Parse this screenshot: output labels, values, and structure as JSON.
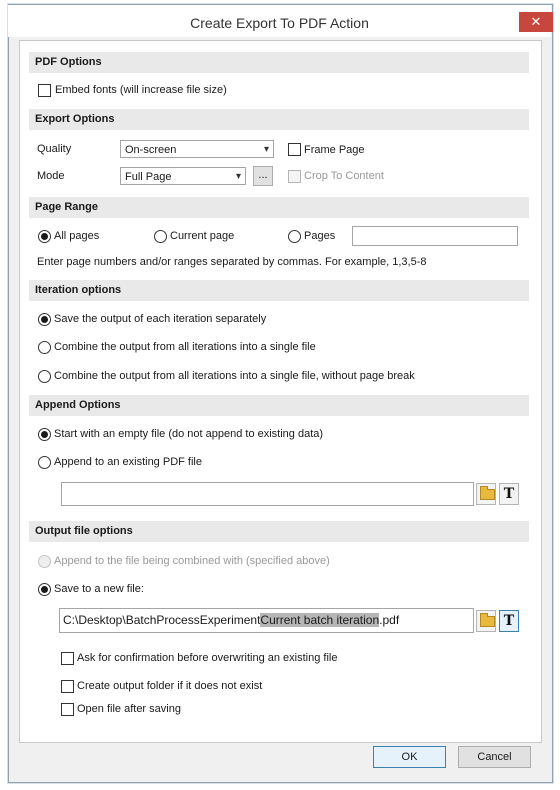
{
  "window": {
    "title": "Create Export To PDF Action",
    "close_icon": "✕"
  },
  "pdf_options": {
    "header": "PDF Options",
    "embed_fonts": "Embed fonts (will increase file size)"
  },
  "export_options": {
    "header": "Export Options",
    "quality_label": "Quality",
    "quality_value": "On-screen",
    "frame_page": "Frame Page",
    "mode_label": "Mode",
    "mode_value": "Full Page",
    "ellipsis": "...",
    "crop_to_content": "Crop To Content"
  },
  "page_range": {
    "header": "Page Range",
    "all_pages": "All pages",
    "current_page": "Current page",
    "pages": "Pages",
    "pages_value": "",
    "hint": "Enter page numbers and/or ranges separated by commas. For example, 1,3,5-8"
  },
  "iteration": {
    "header": "Iteration options",
    "opt1": "Save the output of each iteration separately",
    "opt2": "Combine the output from all iterations into a single file",
    "opt3": "Combine the output from all iterations into a single file, without page break"
  },
  "append": {
    "header": "Append Options",
    "opt1": "Start with an empty file (do not append to existing data)",
    "opt2": "Append to an existing PDF file",
    "path_value": ""
  },
  "output": {
    "header": "Output file options",
    "append_combined": "Append to the file being combined with (specified above)",
    "save_new": "Save to a new file:",
    "path_prefix": "C:\\Desktop\\BatchProcessExperiment",
    "path_token": "Current batch iteration",
    "path_suffix": ".pdf",
    "ask_confirm": "Ask for confirmation before overwriting an existing file",
    "create_folder": "Create output folder if it does not exist",
    "open_after": "Open file after saving"
  },
  "buttons": {
    "ok": "OK",
    "cancel": "Cancel"
  },
  "icons": {
    "folder": "folder-icon",
    "text_token": "T"
  }
}
